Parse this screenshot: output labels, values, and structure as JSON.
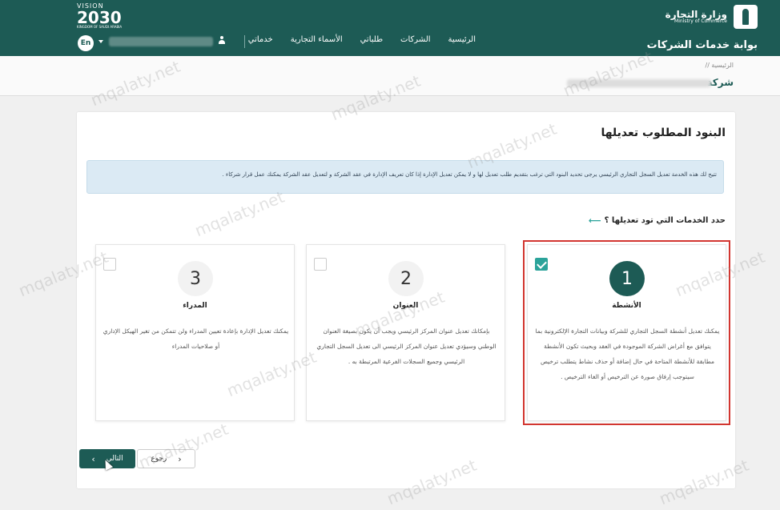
{
  "header": {
    "ministry_ar": "وزارة التجارة",
    "ministry_en": "Ministry of Commerce",
    "portal_title": "بوابة خدمات الشركات",
    "vision_top": "VISION",
    "vision_num": "2030",
    "vision_sub": "KINGDOM OF SAUDI ARABIA",
    "nav": [
      "الرئيسية",
      "الشركات",
      "طلباتي",
      "الأسماء التجارية",
      "خدماتي"
    ],
    "lang": "En"
  },
  "breadcrumb": {
    "path": "الرئيسية  //",
    "company_label": "شركة"
  },
  "card": {
    "title": "البنود المطلوب تعديلها",
    "info": "تتيح لك هذه الخدمة تعديل السجل التجاري الرئيسي يرجى تحديد البنود التي ترغب بتقديم طلب تعديل لها و لا يمكن تعديل الإدارة إذا كان تعريف الإدارة في عقد الشركة و لتعديل عقد الشركة يمكنك عمل قرار شركاء .",
    "section_head": "حدد الخدمات التي تود تعديلها ؟",
    "options": [
      {
        "num": "1",
        "title": "الأنشطة",
        "desc": "يمكنك تعديل أنشطة السجل التجاري للشركة وبيانات التجارة الإلكترونية بما يتوافق مع أغراض الشركة الموجودة في العقد وبحيث تكون الأنشطة مطابقة للأنشطة المتاحة في حال إضافة أو حذف نشاط يتطلب ترخيص سيتوجب إرفاق صورة عن الترخيص أو الغاء الترخيص .",
        "checked": true
      },
      {
        "num": "2",
        "title": "العنوان",
        "desc": "بإمكانك تعديل عنوان المركز الرئيسي ويجب أن يكون بصيغة العنوان الوطني وسيؤدي تعديل عنوان المركز الرئيسي الى تعديل السجل التجاري الرئيسي وجميع السجلات الفرعية المرتبطة به .",
        "checked": false
      },
      {
        "num": "3",
        "title": "المدراء",
        "desc": "يمكنك تعديل الإدارة بإعادة تعيين المدراء ولن تتمكن من تغير الهيكل الإداري أو صلاحيات المدراء",
        "checked": false
      }
    ]
  },
  "buttons": {
    "next": "التالي",
    "back": "رجوع"
  },
  "watermark": "mqalaty.net",
  "colors": {
    "brand": "#1d5b55",
    "accent": "#2ba39a",
    "highlight": "#d23630"
  }
}
